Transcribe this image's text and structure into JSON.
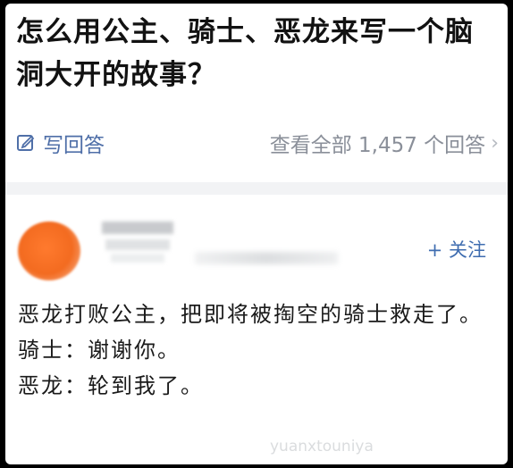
{
  "question": {
    "title": "怎么用公主、骑士、恶龙来写一个脑洞大开的故事？"
  },
  "actions": {
    "write_answer": "写回答",
    "view_all": "查看全部 1,457 个回答",
    "chevron": "›"
  },
  "author": {
    "follow": "+ 关注"
  },
  "answer": {
    "lines": [
      "恶龙打败公主，把即将被掏空的骑士救走了。",
      "骑士：谢谢你。",
      "恶龙：轮到我了。"
    ]
  },
  "watermark": "yuanxtouniya",
  "icons": {
    "write": "edit-icon",
    "chevron": "chevron-right-icon"
  }
}
